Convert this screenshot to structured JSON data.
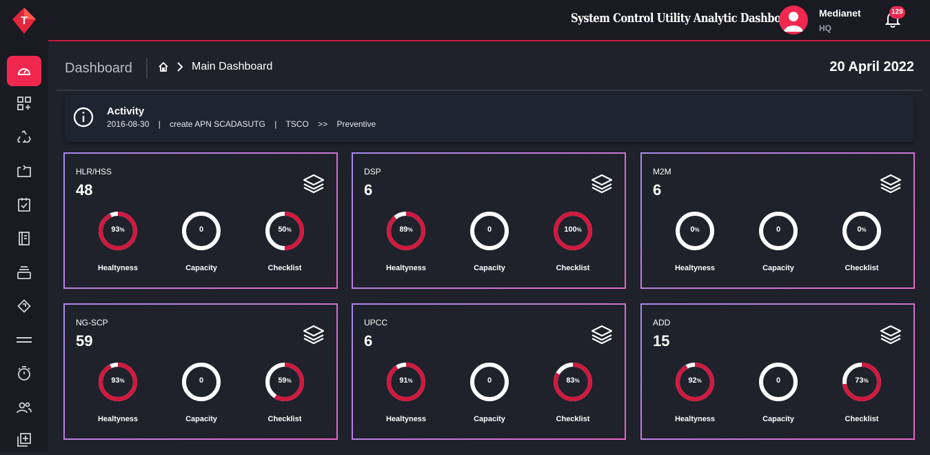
{
  "app": {
    "title": "System Control Utility Analytic Dashboard",
    "logo_letter": "T"
  },
  "user": {
    "name": "Medianet",
    "subtitle": "HQ",
    "notification_count": "129"
  },
  "header": {
    "page_title": "Dashboard",
    "breadcrumb": "Main Dashboard",
    "date": "20 April 2022"
  },
  "activity": {
    "title": "Activity",
    "line": "2016-08-30    |    create APN SCADASUTG    |    TSCO    >>    Preventive"
  },
  "sidebar": {
    "items": [
      {
        "icon": "speedometer-icon",
        "active": true
      },
      {
        "icon": "apps-add-icon",
        "active": false
      },
      {
        "icon": "recycle-icon",
        "active": false
      },
      {
        "icon": "transfer-icon",
        "active": false
      },
      {
        "icon": "calendar-check-icon",
        "active": false
      },
      {
        "icon": "report-icon",
        "active": false
      },
      {
        "icon": "stack-icon",
        "active": false
      },
      {
        "icon": "diagonal-arrows-icon",
        "active": false
      },
      {
        "icon": "menu-lines-icon",
        "active": false
      },
      {
        "icon": "stopwatch-icon",
        "active": false
      },
      {
        "icon": "users-icon",
        "active": false
      },
      {
        "icon": "add-box-icon",
        "active": false
      }
    ]
  },
  "metric_labels": [
    "Healtyness",
    "Capacity",
    "Checklist"
  ],
  "colors": {
    "accent": "#f0284f",
    "ring_fill": "#d0193f",
    "ring_track": "#ffffff"
  },
  "cards": [
    {
      "name": "HLR/HSS",
      "count": "48",
      "metrics": [
        {
          "value": "93",
          "unit": "%",
          "percent": 93
        },
        {
          "value": "0",
          "unit": "",
          "percent": 0
        },
        {
          "value": "50",
          "unit": "%",
          "percent": 50
        }
      ]
    },
    {
      "name": "DSP",
      "count": "6",
      "metrics": [
        {
          "value": "89",
          "unit": "%",
          "percent": 89
        },
        {
          "value": "0",
          "unit": "",
          "percent": 0
        },
        {
          "value": "100",
          "unit": "%",
          "percent": 100
        }
      ]
    },
    {
      "name": "M2M",
      "count": "6",
      "metrics": [
        {
          "value": "0",
          "unit": "%",
          "percent": 0
        },
        {
          "value": "0",
          "unit": "",
          "percent": 0
        },
        {
          "value": "0",
          "unit": "%",
          "percent": 0
        }
      ]
    },
    {
      "name": "NG-SCP",
      "count": "59",
      "metrics": [
        {
          "value": "93",
          "unit": "%",
          "percent": 93
        },
        {
          "value": "0",
          "unit": "",
          "percent": 0
        },
        {
          "value": "59",
          "unit": "%",
          "percent": 59
        }
      ]
    },
    {
      "name": "UPCC",
      "count": "6",
      "metrics": [
        {
          "value": "91",
          "unit": "%",
          "percent": 91
        },
        {
          "value": "0",
          "unit": "",
          "percent": 0
        },
        {
          "value": "83",
          "unit": "%",
          "percent": 83
        }
      ]
    },
    {
      "name": "ADD",
      "count": "15",
      "metrics": [
        {
          "value": "92",
          "unit": "%",
          "percent": 92
        },
        {
          "value": "0",
          "unit": "",
          "percent": 0
        },
        {
          "value": "73",
          "unit": "%",
          "percent": 73
        }
      ]
    }
  ]
}
